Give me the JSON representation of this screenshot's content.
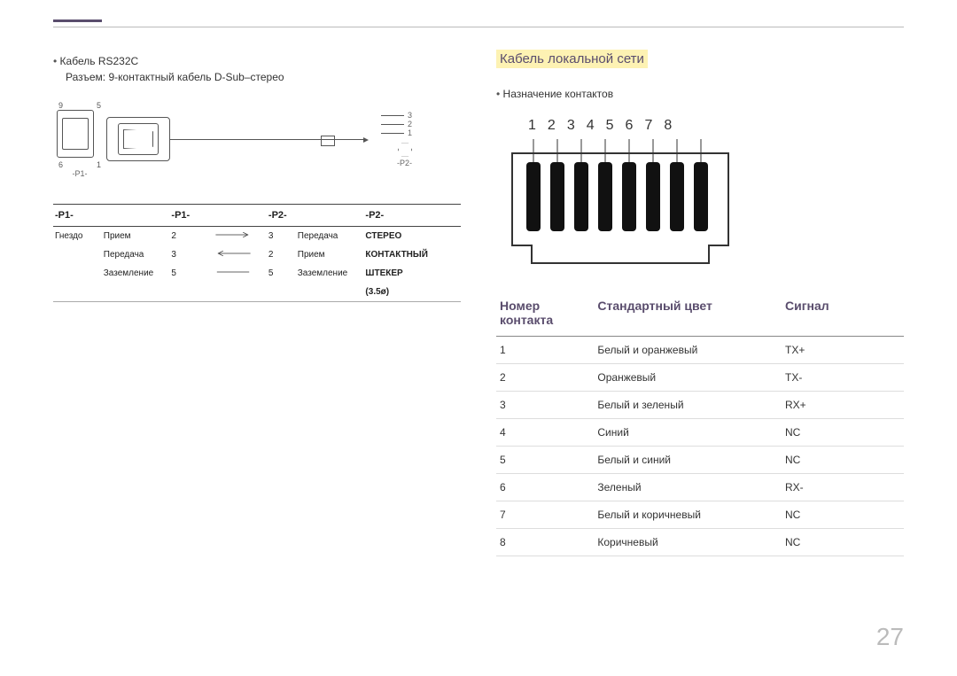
{
  "page_number": "27",
  "left": {
    "cable_title": "Кабель RS232C",
    "connector_desc": "Разъем: 9-контактный кабель D-Sub–стерео",
    "diagram": {
      "dsub_pin_top_left": "9",
      "dsub_pin_top_right": "5",
      "dsub_pin_bottom_left": "6",
      "dsub_pin_bottom_right": "1",
      "p1_label": "-P1-",
      "p2_label": "-P2-",
      "wire1": "3",
      "wire2": "2",
      "wire3": "1"
    },
    "headers": [
      "-P1-",
      "-P1-",
      "-P2-",
      "-P2-"
    ],
    "rows": [
      {
        "a": "Гнездо",
        "b": "Прием",
        "c": "2",
        "dir": "r",
        "e": "3",
        "f": "Передача",
        "g": "СТЕРЕО"
      },
      {
        "a": "",
        "b": "Передача",
        "c": "3",
        "dir": "l",
        "e": "2",
        "f": "Прием",
        "g": "КОНТАКТНЫЙ"
      },
      {
        "a": "",
        "b": "Заземление",
        "c": "5",
        "dir": "-",
        "e": "5",
        "f": "Заземление",
        "g": "ШТЕКЕР"
      },
      {
        "a": "",
        "b": "",
        "c": "",
        "dir": "",
        "e": "",
        "f": "",
        "g": "(3.5ø)"
      }
    ]
  },
  "right": {
    "heading": "Кабель локальной сети",
    "subheading": "Назначение контактов",
    "rj_numbers": [
      "1",
      "2",
      "3",
      "4",
      "5",
      "6",
      "7",
      "8"
    ],
    "headers": {
      "pin": "Номер контакта",
      "color": "Стандартный цвет",
      "signal": "Сигнал"
    },
    "rows": [
      {
        "pin": "1",
        "color": "Белый и оранжевый",
        "signal": "TX+"
      },
      {
        "pin": "2",
        "color": "Оранжевый",
        "signal": "TX-"
      },
      {
        "pin": "3",
        "color": "Белый и зеленый",
        "signal": "RX+"
      },
      {
        "pin": "4",
        "color": "Синий",
        "signal": "NC"
      },
      {
        "pin": "5",
        "color": "Белый и синий",
        "signal": "NC"
      },
      {
        "pin": "6",
        "color": "Зеленый",
        "signal": "RX-"
      },
      {
        "pin": "7",
        "color": "Белый и коричневый",
        "signal": "NC"
      },
      {
        "pin": "8",
        "color": "Коричневый",
        "signal": "NC"
      }
    ]
  }
}
